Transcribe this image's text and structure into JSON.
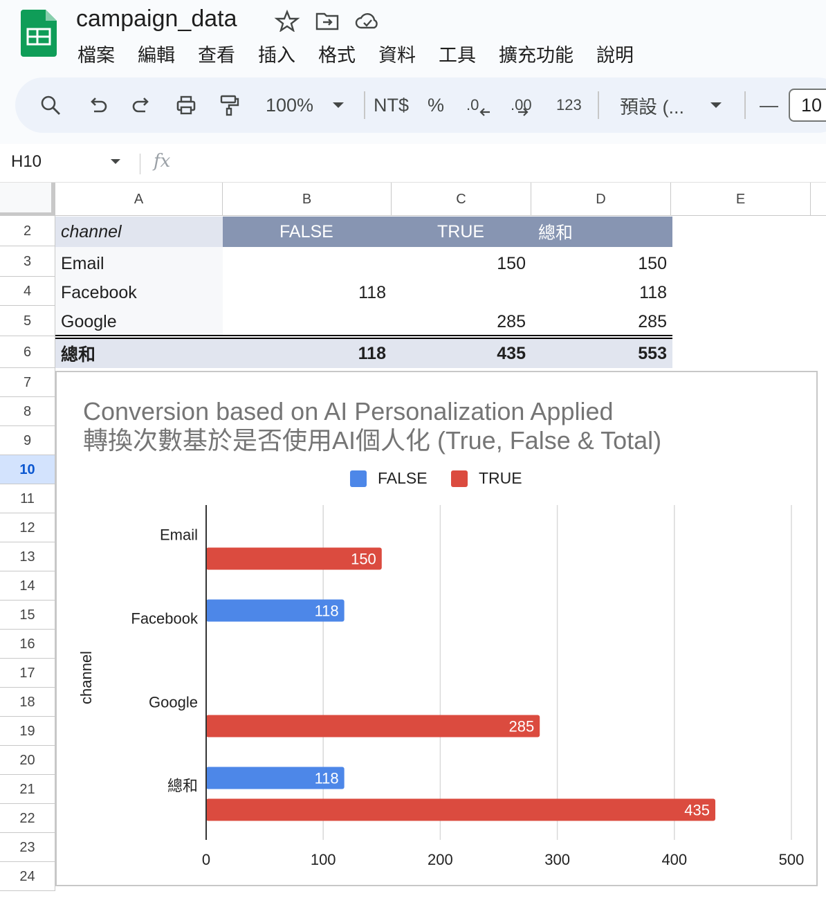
{
  "app": {
    "doc_title": "campaign_data",
    "menu": [
      "檔案",
      "編輯",
      "查看",
      "插入",
      "格式",
      "資料",
      "工具",
      "擴充功能",
      "說明"
    ],
    "toolbar": {
      "zoom": "100%",
      "currency": "NT$",
      "percent": "%",
      "dec_decrease": ".0",
      "dec_increase": ".00",
      "number_format": "123",
      "font": "預設 (...",
      "minus": "—",
      "font_size": "10"
    },
    "name_box": "H10",
    "fx": "fx"
  },
  "colors": {
    "false_series": "#4d87e8",
    "true_series": "#db4b3f",
    "pivot_header": "#8795b2",
    "selected_row": "#d3e3fd"
  },
  "columns": [
    "A",
    "B",
    "C",
    "D",
    "E"
  ],
  "rows": [
    "2",
    "3",
    "4",
    "5",
    "6",
    "7",
    "8",
    "9",
    "10",
    "11",
    "12",
    "13",
    "14",
    "15",
    "16",
    "17",
    "18",
    "19",
    "20",
    "21",
    "22",
    "23",
    "24"
  ],
  "pivot": {
    "header": {
      "channel": "channel",
      "false": "FALSE",
      "true": "TRUE",
      "total": "總和"
    },
    "body": [
      {
        "channel": "Email",
        "false": "",
        "true": "150",
        "total": "150"
      },
      {
        "channel": "Facebook",
        "false": "118",
        "true": "",
        "total": "118"
      },
      {
        "channel": "Google",
        "false": "",
        "true": "285",
        "total": "285"
      }
    ],
    "grand_total": {
      "label": "總和",
      "false": "118",
      "true": "435",
      "total": "553"
    }
  },
  "chart_data": {
    "type": "bar",
    "orientation": "horizontal",
    "title": "Conversion based on AI Personalization Applied",
    "subtitle": "轉換次數基於是否使用AI個人化 (True, False & Total)",
    "ylabel": "channel",
    "xlabel": "",
    "categories": [
      "Email",
      "Facebook",
      "Google",
      "總和"
    ],
    "series": [
      {
        "name": "FALSE",
        "values": [
          null,
          118,
          null,
          118
        ]
      },
      {
        "name": "TRUE",
        "values": [
          150,
          null,
          285,
          435
        ]
      }
    ],
    "xlim": [
      0,
      500
    ],
    "xticks": [
      "0",
      "100",
      "200",
      "300",
      "400",
      "500"
    ],
    "grid": true,
    "legend": "top"
  }
}
